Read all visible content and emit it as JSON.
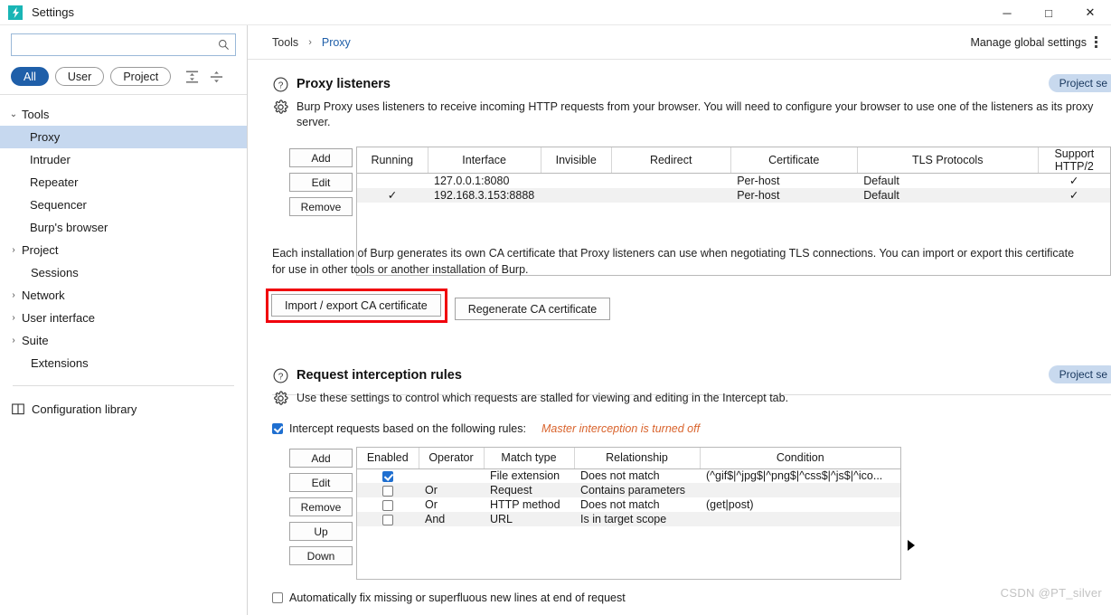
{
  "window": {
    "title": "Settings",
    "logo_icon": "burp-lightning-icon",
    "logo_glyph": "⚡",
    "minimize_label": "─",
    "maximize_label": "□",
    "close_label": "✕"
  },
  "sidebar": {
    "search": {
      "value": "",
      "placeholder": "",
      "icon": "search-icon"
    },
    "filters": [
      {
        "label": "All",
        "active": true
      },
      {
        "label": "User",
        "active": false
      },
      {
        "label": "Project",
        "active": false
      }
    ],
    "tree_controls": [
      {
        "name": "collapse-all-icon"
      },
      {
        "name": "expand-all-icon"
      }
    ],
    "tree": [
      {
        "label": "Tools",
        "chevron": "⌄",
        "expanded": true,
        "depth": 0,
        "selected": false
      },
      {
        "label": "Proxy",
        "chevron": "",
        "depth": 1,
        "selected": true
      },
      {
        "label": "Intruder",
        "chevron": "",
        "depth": 1,
        "selected": false
      },
      {
        "label": "Repeater",
        "chevron": "",
        "depth": 1,
        "selected": false
      },
      {
        "label": "Sequencer",
        "chevron": "",
        "depth": 1,
        "selected": false
      },
      {
        "label": "Burp's browser",
        "chevron": "",
        "depth": 1,
        "selected": false
      },
      {
        "label": "Project",
        "chevron": "›",
        "depth": 0,
        "selected": false
      },
      {
        "label": "Sessions",
        "chevron": "",
        "depth": 0,
        "selected": false
      },
      {
        "label": "Network",
        "chevron": "›",
        "depth": 0,
        "selected": false
      },
      {
        "label": "User interface",
        "chevron": "›",
        "depth": 0,
        "selected": false
      },
      {
        "label": "Suite",
        "chevron": "›",
        "depth": 0,
        "selected": false
      },
      {
        "label": "Extensions",
        "chevron": "",
        "depth": 0,
        "selected": false
      }
    ],
    "library": {
      "label": "Configuration library",
      "icon": "book-icon"
    }
  },
  "breadcrumb": {
    "root": "Tools",
    "separator": "›",
    "current": "Proxy",
    "manage_global_settings": "Manage global settings",
    "kebab_icon": "kebab-menu-icon"
  },
  "proxy_listeners": {
    "help_icon": "question-circle-icon",
    "gear_icon": "gear-icon",
    "title": "Proxy listeners",
    "description": "Burp Proxy uses listeners to receive incoming HTTP requests from your browser. You will need to configure your browser to use one of the listeners as its proxy server.",
    "scope_badge": "Project se",
    "buttons": [
      "Add",
      "Edit",
      "Remove"
    ],
    "columns": [
      "Running",
      "Interface",
      "Invisible",
      "Redirect",
      "Certificate",
      "TLS Protocols",
      "Support HTTP/2"
    ],
    "rows": [
      {
        "running": "",
        "interface": "127.0.0.1:8080",
        "invisible": "",
        "redirect": "",
        "certificate": "Per-host",
        "tls": "Default",
        "http2": "✓"
      },
      {
        "running": "✓",
        "interface": "192.168.3.153:8888",
        "invisible": "",
        "redirect": "",
        "certificate": "Per-host",
        "tls": "Default",
        "http2": "✓"
      }
    ]
  },
  "ca_certificate": {
    "paragraph": "Each installation of Burp generates its own CA certificate that Proxy listeners can use when negotiating TLS connections. You can import or export this certificate for use in other tools or another installation of Burp.",
    "import_export_button": "Import / export CA certificate",
    "regenerate_button": "Regenerate CA certificate",
    "highlight_color": "#f0000c"
  },
  "request_interception": {
    "help_icon": "question-circle-icon",
    "gear_icon": "gear-icon",
    "title": "Request interception rules",
    "description": "Use these settings to control which requests are stalled for viewing and editing in the Intercept tab.",
    "scope_badge": "Project se",
    "intercept_checkbox": {
      "label": "Intercept requests based on the following rules:",
      "checked": true
    },
    "master_note": "Master interception is turned off",
    "buttons": [
      "Add",
      "Edit",
      "Remove",
      "Up",
      "Down"
    ],
    "columns": [
      "Enabled",
      "Operator",
      "Match type",
      "Relationship",
      "Condition"
    ],
    "rows": [
      {
        "enabled": true,
        "operator": "",
        "match_type": "File extension",
        "relationship": "Does not match",
        "condition": "(^gif$|^jpg$|^png$|^css$|^js$|^ico..."
      },
      {
        "enabled": false,
        "operator": "Or",
        "match_type": "Request",
        "relationship": "Contains parameters",
        "condition": ""
      },
      {
        "enabled": false,
        "operator": "Or",
        "match_type": "HTTP method",
        "relationship": "Does not match",
        "condition": "(get|post)"
      },
      {
        "enabled": false,
        "operator": "And",
        "match_type": "URL",
        "relationship": "Is in target scope",
        "condition": ""
      }
    ],
    "expand_handle_icon": "expand-right-triangle-icon",
    "bottom_checkbox": {
      "label": "Automatically fix missing or superfluous new lines at end of request",
      "checked": false
    }
  },
  "watermark": "CSDN @PT_silver"
}
